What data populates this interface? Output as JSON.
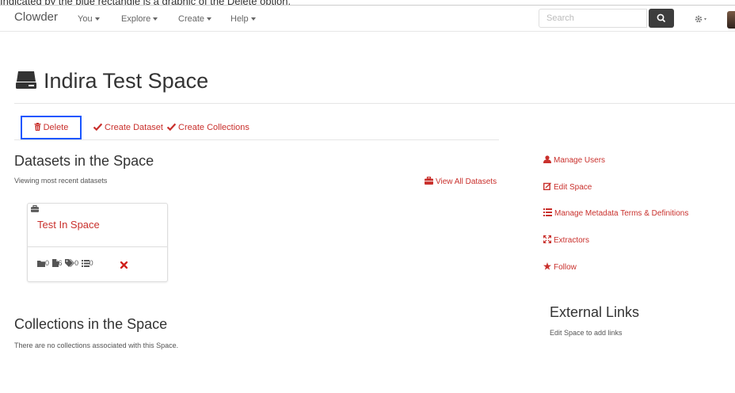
{
  "caption": "Indicated by the blue rectangle is a graphic of the Delete option.",
  "navbar": {
    "brand": "Clowder",
    "menu": [
      {
        "label": "You"
      },
      {
        "label": "Explore"
      },
      {
        "label": "Create"
      },
      {
        "label": "Help"
      }
    ],
    "search_placeholder": "Search"
  },
  "page": {
    "title": "Indira Test Space"
  },
  "actions": {
    "delete": "Delete",
    "create_dataset": "Create Dataset",
    "create_collections": "Create Collections"
  },
  "datasets": {
    "title": "Datasets in the Space",
    "subtitle": "Viewing most recent datasets",
    "view_all": "View All Datasets",
    "items": [
      {
        "name": "Test In Space",
        "folders": "0",
        "files": "6",
        "tags": "0",
        "comments": "0"
      }
    ]
  },
  "collections": {
    "title": "Collections in the Space",
    "empty_message": "There are no collections associated with this Space."
  },
  "sidebar": {
    "links": [
      {
        "label": "Manage Users",
        "icon": "user-icon"
      },
      {
        "label": "Edit Space",
        "icon": "edit-icon"
      },
      {
        "label": "Manage Metadata Terms & Definitions",
        "icon": "list-icon"
      },
      {
        "label": "Extractors",
        "icon": "fullscreen-icon"
      },
      {
        "label": "Follow",
        "icon": "star-icon"
      }
    ],
    "external_links_title": "External Links",
    "external_links_text": "Edit Space to add links"
  },
  "colors": {
    "link_red": "#c9302c",
    "highlight_blue": "#1a56ff",
    "search_button": "#3d3d3d"
  }
}
